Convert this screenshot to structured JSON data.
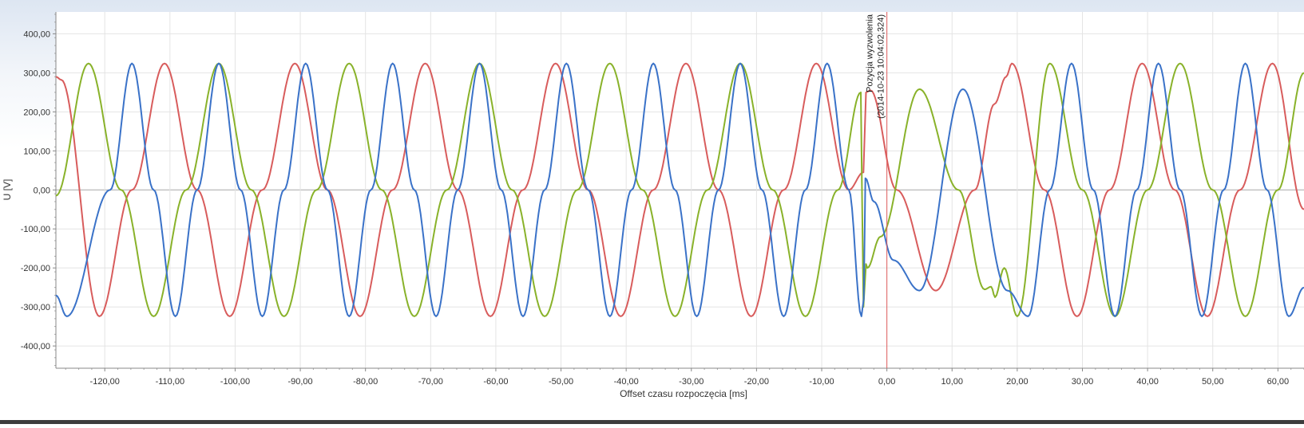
{
  "chart_data": {
    "type": "line",
    "xlabel": "Offset czasu rozpoczęcia [ms]",
    "ylabel": "U [V]",
    "xlim": [
      -127.5,
      64
    ],
    "ylim": [
      -457,
      456
    ],
    "grid": true,
    "x_ticks": [
      -120,
      -110,
      -100,
      -90,
      -80,
      -70,
      -60,
      -50,
      -40,
      -30,
      -20,
      -10,
      0,
      10,
      20,
      30,
      40,
      50,
      60
    ],
    "x_tick_labels": [
      "-120,00",
      "-110,00",
      "-100,00",
      "-90,00",
      "-80,00",
      "-70,00",
      "-60,00",
      "-50,00",
      "-40,00",
      "-30,00",
      "-20,00",
      "-10,00",
      "0,00",
      "10,00",
      "20,00",
      "30,00",
      "40,00",
      "50,00",
      "60,00"
    ],
    "y_ticks": [
      400,
      300,
      200,
      100,
      0,
      -100,
      -200,
      -300,
      -400
    ],
    "y_tick_labels": [
      "400,00",
      "300,00",
      "200,00",
      "100,00",
      "0,00",
      "-100,00",
      "-200,00",
      "-300,00",
      "-400,00"
    ],
    "trigger": {
      "x": 0,
      "label_line1": "Pozycja wyzwolenia",
      "label_line2": "(2014-10-23 10:04:02,324)",
      "color": "#e06060"
    },
    "series": [
      {
        "color": "#d85c5c",
        "x": [
          -127.5,
          -126.67,
          -120.83,
          -115.83,
          -110.83,
          -105.83,
          -100.83,
          -95.83,
          -90.83,
          -85.83,
          -80.83,
          -75.83,
          -70.83,
          -65.83,
          -60.83,
          -55.83,
          -50.83,
          -45.83,
          -40.83,
          -35.83,
          -30.83,
          -25.83,
          -20.83,
          -15.83,
          -10.83,
          -5.83,
          -3.6,
          -3.2,
          -2.5,
          1.5,
          7.5,
          13.5,
          16.5,
          18.3,
          19.17,
          24.17,
          29.17,
          34.17,
          39.17,
          44.17,
          49.17,
          54.17,
          59.17,
          64.0
        ],
        "values": [
          290,
          282,
          -324,
          0,
          324,
          0,
          -324,
          0,
          324,
          0,
          -324,
          0,
          324,
          0,
          -324,
          0,
          324,
          0,
          -324,
          0,
          324,
          0,
          -324,
          0,
          324,
          0,
          45,
          250,
          255,
          0,
          -258,
          0,
          220,
          290,
          324,
          0,
          -324,
          0,
          324,
          0,
          -324,
          0,
          324,
          -50
        ]
      },
      {
        "color": "#89b22a",
        "x": [
          -127.5,
          -122.5,
          -117.5,
          -112.5,
          -107.5,
          -102.5,
          -97.5,
          -92.5,
          -87.5,
          -82.5,
          -77.5,
          -72.5,
          -67.5,
          -62.5,
          -57.5,
          -52.5,
          -47.5,
          -42.5,
          -37.5,
          -32.5,
          -27.5,
          -22.5,
          -17.5,
          -12.5,
          -7.5,
          -4.0,
          -3.6,
          -3.2,
          -3.0,
          -1.0,
          5.0,
          11.0,
          15.0,
          16.0,
          16.6,
          18.0,
          20.0,
          25.0,
          30.0,
          35.0,
          40.0,
          45.0,
          50.0,
          55.0,
          60.0,
          64.0
        ],
        "values": [
          -15,
          324,
          0,
          -324,
          0,
          324,
          0,
          -324,
          0,
          324,
          0,
          -324,
          0,
          324,
          0,
          -324,
          0,
          324,
          0,
          -324,
          0,
          324,
          0,
          -324,
          0,
          250,
          -300,
          -190,
          -200,
          -120,
          258,
          0,
          -255,
          -248,
          -275,
          -200,
          -324,
          324,
          0,
          -324,
          0,
          324,
          0,
          -324,
          0,
          300
        ]
      },
      {
        "color": "#3a72c8",
        "x": [
          -127.5,
          -125.83,
          -119.17,
          -115.83,
          -112.5,
          -109.17,
          -105.83,
          -102.5,
          -99.17,
          -95.83,
          -92.5,
          -89.17,
          -85.83,
          -82.5,
          -79.17,
          -75.83,
          -72.5,
          -69.17,
          -65.83,
          -62.5,
          -59.17,
          -55.83,
          -52.5,
          -49.17,
          -45.83,
          -42.5,
          -39.17,
          -35.83,
          -32.5,
          -29.17,
          -25.83,
          -22.5,
          -19.17,
          -15.83,
          -12.5,
          -9.17,
          -5.83,
          -3.9,
          -3.55,
          -3.3,
          -2.0,
          1.0,
          5.0,
          11.67,
          18.5,
          21.67,
          25.0,
          28.33,
          31.67,
          35.0,
          38.33,
          41.67,
          45.0,
          48.33,
          51.67,
          55.0,
          58.33,
          61.67,
          64.0
        ],
        "values": [
          -270,
          -324,
          0,
          324,
          0,
          -324,
          0,
          324,
          0,
          -324,
          0,
          324,
          0,
          -324,
          0,
          324,
          0,
          -324,
          0,
          324,
          0,
          -324,
          0,
          324,
          0,
          -324,
          0,
          324,
          0,
          -324,
          0,
          324,
          0,
          -324,
          0,
          324,
          0,
          -324,
          -280,
          30,
          -30,
          -180,
          -258,
          258,
          -258,
          -324,
          0,
          324,
          0,
          -324,
          0,
          324,
          0,
          -324,
          0,
          324,
          0,
          -324,
          -250
        ]
      }
    ]
  }
}
